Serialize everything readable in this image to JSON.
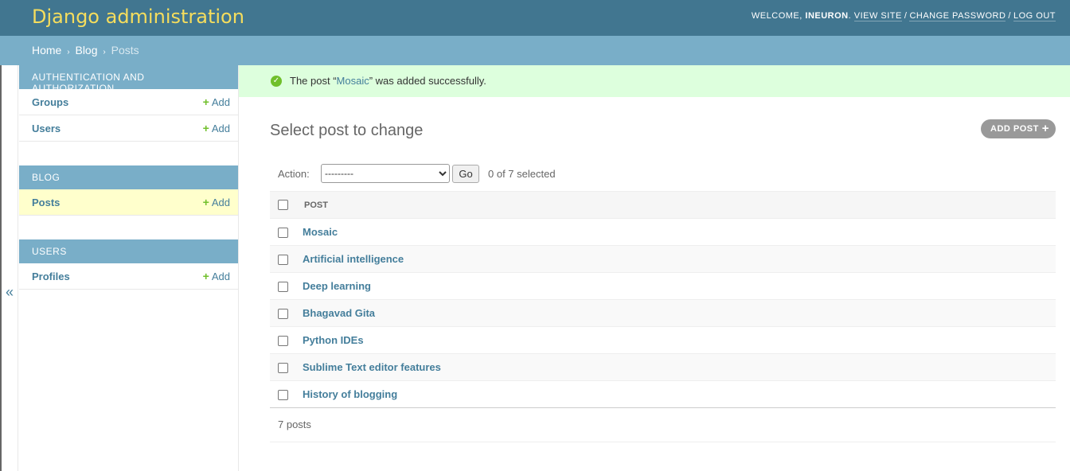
{
  "header": {
    "branding": "Django administration",
    "welcome": "Welcome,",
    "username": "ineuron",
    "view_site": "View site",
    "change_password": "Change password",
    "log_out": "Log out"
  },
  "breadcrumbs": {
    "home": "Home",
    "app": "Blog",
    "current": "Posts",
    "separator": "›"
  },
  "sidebar": {
    "toggle": "«",
    "add_label": "Add",
    "modules": [
      {
        "caption": "Authentication and Authorization",
        "models": [
          {
            "name": "Groups"
          },
          {
            "name": "Users"
          }
        ]
      },
      {
        "caption": "Blog",
        "models": [
          {
            "name": "Posts"
          }
        ]
      },
      {
        "caption": "Users",
        "models": [
          {
            "name": "Profiles"
          }
        ]
      }
    ]
  },
  "messages": {
    "prefix": "The post “",
    "link": "Mosaic",
    "suffix": "” was added successfully."
  },
  "main": {
    "title": "Select post to change",
    "add_button": "Add post",
    "action_label": "Action:",
    "action_selected": "---------",
    "go_button": "Go",
    "selected_counter": "0 of 7 selected",
    "column_header": "Post",
    "rows": [
      "Mosaic",
      "Artificial intelligence",
      "Deep learning",
      "Bhagavad Gita",
      "Python IDEs",
      "Sublime Text editor features",
      "History of blogging"
    ],
    "paginator": "7 posts"
  },
  "colors": {
    "header_bg": "#417690",
    "branding": "#f5dd5d",
    "breadcrumb_bg": "#79aec8",
    "link": "#447e9b",
    "success_bg": "#ddffdd",
    "add_icon": "#70bf2b",
    "current_row": "#ffffcc"
  }
}
